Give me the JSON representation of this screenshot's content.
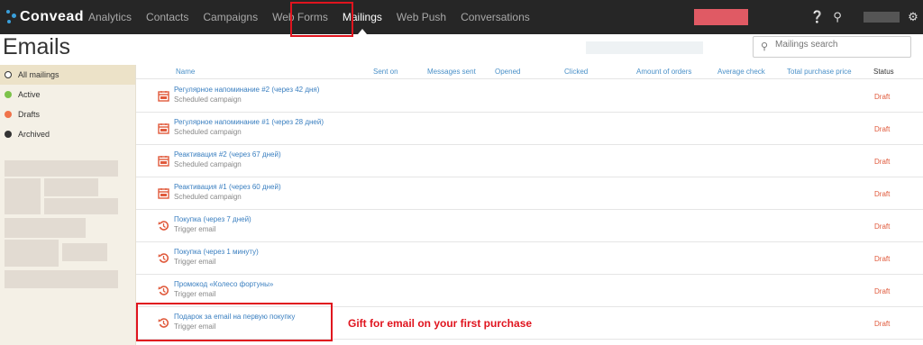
{
  "app": {
    "logo_text": "Convead",
    "page_title": "Emails"
  },
  "nav": [
    {
      "label": "Analytics",
      "active": false
    },
    {
      "label": "Contacts",
      "active": false
    },
    {
      "label": "Campaigns",
      "active": false
    },
    {
      "label": "Web Forms",
      "active": false
    },
    {
      "label": "Mailings",
      "active": true
    },
    {
      "label": "Web Push",
      "active": false
    },
    {
      "label": "Conversations",
      "active": false
    }
  ],
  "top_icons": [
    "help-icon",
    "search-icon",
    "gear-icon"
  ],
  "search": {
    "placeholder": "Mailings search"
  },
  "filters": [
    {
      "label": "All mailings",
      "color": "#ffffff",
      "active": true
    },
    {
      "label": "Active",
      "color": "#7cc24a",
      "active": false
    },
    {
      "label": "Drafts",
      "color": "#f0734a",
      "active": false
    },
    {
      "label": "Archived",
      "color": "#333333",
      "active": false
    }
  ],
  "columns": [
    "Name",
    "Sent on",
    "Messages sent",
    "Opened",
    "Clicked",
    "Amount of orders",
    "Average check",
    "Total purchase price",
    "Status"
  ],
  "mailings": [
    {
      "name": "Регулярное напоминание #2 (через 42 дня)",
      "type": "Scheduled campaign",
      "icon": "calendar-icon",
      "status": "Draft"
    },
    {
      "name": "Регулярное напоминание #1 (через 28 дней)",
      "type": "Scheduled campaign",
      "icon": "calendar-icon",
      "status": "Draft"
    },
    {
      "name": "Реактивация #2 (через 67 дней)",
      "type": "Scheduled campaign",
      "icon": "calendar-icon",
      "status": "Draft"
    },
    {
      "name": "Реактивация #1 (через 60 дней)",
      "type": "Scheduled campaign",
      "icon": "calendar-icon",
      "status": "Draft"
    },
    {
      "name": "Покупка (через 7 дней)",
      "type": "Trigger email",
      "icon": "trigger-icon",
      "status": "Draft"
    },
    {
      "name": "Покупка (через 1 минуту)",
      "type": "Trigger email",
      "icon": "trigger-icon",
      "status": "Draft"
    },
    {
      "name": "Промокод «Колесо фортуны»",
      "type": "Trigger email",
      "icon": "trigger-icon",
      "status": "Draft"
    },
    {
      "name": "Подарок за email на первую покупку",
      "type": "Trigger email",
      "icon": "trigger-icon",
      "status": "Draft"
    }
  ],
  "annotation": "Gift for email on your first purchase",
  "colors": {
    "topbar": "#262626",
    "link": "#3a7fc0",
    "draft": "#e05a3c",
    "highlight": "#e0141e",
    "accent": "#3aa0dc"
  }
}
